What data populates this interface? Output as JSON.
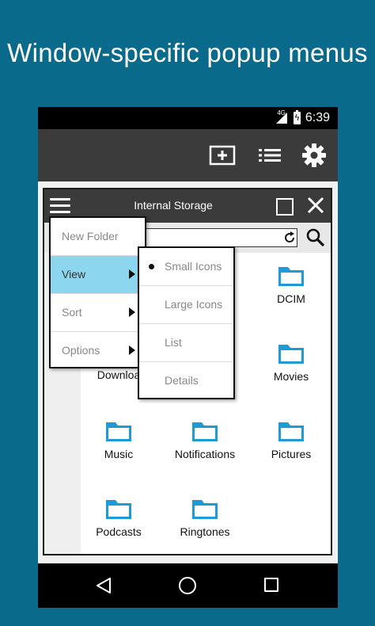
{
  "headline": "Window-specific popup menus",
  "status": {
    "network": "4G",
    "time": "6:39"
  },
  "toolbar": {
    "icons": [
      "add-window-icon",
      "list-icon",
      "settings-icon"
    ]
  },
  "window": {
    "title": "Internal Storage",
    "search_value": ""
  },
  "folders": [
    {
      "label": "DCIM"
    },
    {
      "label": "Downloa"
    },
    {
      "label": "Movies"
    },
    {
      "label": "Music"
    },
    {
      "label": "Notifications"
    },
    {
      "label": "Pictures"
    },
    {
      "label": "Podcasts"
    },
    {
      "label": "Ringtones"
    }
  ],
  "menu": {
    "items": [
      {
        "label": "New Folder"
      },
      {
        "label": "View"
      },
      {
        "label": "Sort"
      },
      {
        "label": "Options"
      }
    ]
  },
  "submenu": {
    "items": [
      {
        "label": "Small Icons",
        "selected": true
      },
      {
        "label": "Large Icons"
      },
      {
        "label": "List"
      },
      {
        "label": "Details"
      }
    ]
  },
  "colors": {
    "background": "#0a6a8c",
    "folder": "#1e9ad6",
    "menu_highlight": "#8dd6f0",
    "bar": "#3b3b3b"
  }
}
